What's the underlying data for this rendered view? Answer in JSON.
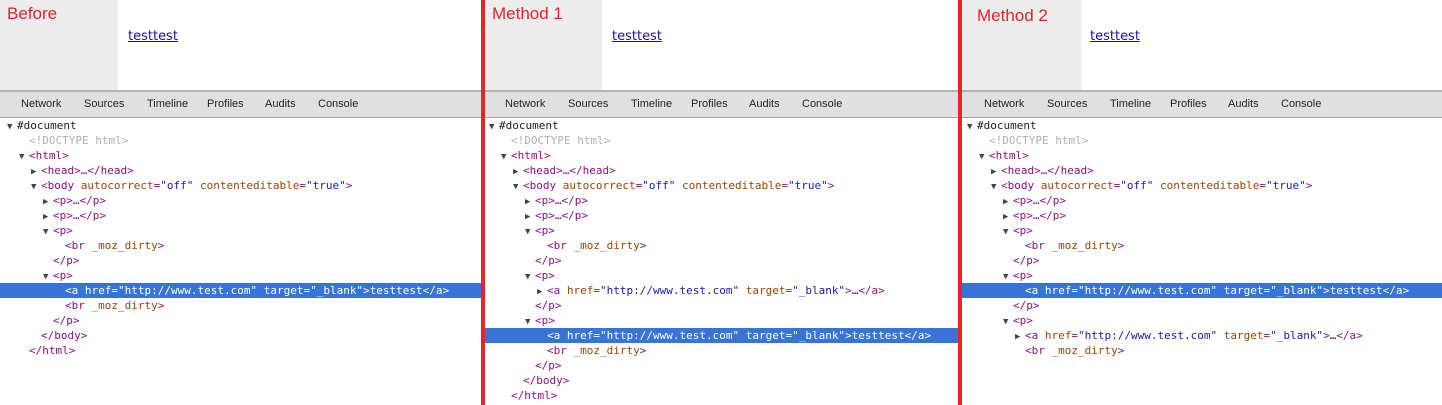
{
  "colors": {
    "divider": "#e8232b",
    "selection": "#3874d8",
    "tag": "#881280",
    "attr": "#994500",
    "value": "#1a1aa6"
  },
  "tabs": [
    "Network",
    "Sources",
    "Timeline",
    "Profiles",
    "Audits",
    "Console"
  ],
  "strings": {
    "document": "#document",
    "doctype": "<!DOCTYPE html>",
    "html_open": "<html>",
    "html_close": "</html>",
    "head": "<head>…</head>",
    "body_tag": "body",
    "body_attr1": "autocorrect",
    "body_val1": "\"off\"",
    "body_attr2": "contenteditable",
    "body_val2": "\"true\"",
    "body_close": "</body>",
    "p_collapsed": "<p>…</p>",
    "p_open": "<p>",
    "p_close": "</p>",
    "br_tag": "br",
    "br_attr": "_moz_dirty",
    "a_tag": "a",
    "a_attr1": "href",
    "a_val1": "\"http://www.test.com\"",
    "a_attr2": "target",
    "a_val2": "\"_blank\"",
    "a_text": "testtest",
    "a_ellipsis": "…",
    "a_close": "</a>"
  },
  "panels": [
    {
      "title": "Before",
      "link_text": "testtest",
      "lines": [
        {
          "indent": 0,
          "arrow": "down",
          "type": "doc"
        },
        {
          "indent": 1,
          "arrow": "none",
          "type": "doctype"
        },
        {
          "indent": 1,
          "arrow": "down",
          "type": "html_open"
        },
        {
          "indent": 2,
          "arrow": "right",
          "type": "head"
        },
        {
          "indent": 2,
          "arrow": "down",
          "type": "body_open"
        },
        {
          "indent": 3,
          "arrow": "right",
          "type": "p_collapsed"
        },
        {
          "indent": 3,
          "arrow": "right",
          "type": "p_collapsed"
        },
        {
          "indent": 3,
          "arrow": "down",
          "type": "p_open"
        },
        {
          "indent": 4,
          "arrow": "none",
          "type": "br"
        },
        {
          "indent": 3,
          "arrow": "none",
          "type": "p_close"
        },
        {
          "indent": 3,
          "arrow": "down",
          "type": "p_open"
        },
        {
          "indent": 4,
          "arrow": "none",
          "type": "a_full",
          "selected": true
        },
        {
          "indent": 4,
          "arrow": "none",
          "type": "br"
        },
        {
          "indent": 3,
          "arrow": "none",
          "type": "p_close"
        },
        {
          "indent": 2,
          "arrow": "none",
          "type": "body_close"
        },
        {
          "indent": 1,
          "arrow": "none",
          "type": "html_close"
        }
      ]
    },
    {
      "title": "Method 1",
      "link_text": "testtest",
      "lines": [
        {
          "indent": 0,
          "arrow": "down",
          "type": "doc"
        },
        {
          "indent": 1,
          "arrow": "none",
          "type": "doctype"
        },
        {
          "indent": 1,
          "arrow": "down",
          "type": "html_open"
        },
        {
          "indent": 2,
          "arrow": "right",
          "type": "head"
        },
        {
          "indent": 2,
          "arrow": "down",
          "type": "body_open"
        },
        {
          "indent": 3,
          "arrow": "right",
          "type": "p_collapsed"
        },
        {
          "indent": 3,
          "arrow": "right",
          "type": "p_collapsed"
        },
        {
          "indent": 3,
          "arrow": "down",
          "type": "p_open"
        },
        {
          "indent": 4,
          "arrow": "none",
          "type": "br"
        },
        {
          "indent": 3,
          "arrow": "none",
          "type": "p_close"
        },
        {
          "indent": 3,
          "arrow": "down",
          "type": "p_open"
        },
        {
          "indent": 4,
          "arrow": "right",
          "type": "a_collapsed"
        },
        {
          "indent": 3,
          "arrow": "none",
          "type": "p_close"
        },
        {
          "indent": 3,
          "arrow": "down",
          "type": "p_open"
        },
        {
          "indent": 4,
          "arrow": "none",
          "type": "a_full",
          "selected": true
        },
        {
          "indent": 4,
          "arrow": "none",
          "type": "br"
        },
        {
          "indent": 3,
          "arrow": "none",
          "type": "p_close"
        },
        {
          "indent": 2,
          "arrow": "none",
          "type": "body_close"
        },
        {
          "indent": 1,
          "arrow": "none",
          "type": "html_close"
        }
      ]
    },
    {
      "title": "Method 2",
      "link_text": "testtest",
      "lines": [
        {
          "indent": 0,
          "arrow": "down",
          "type": "doc"
        },
        {
          "indent": 1,
          "arrow": "none",
          "type": "doctype"
        },
        {
          "indent": 1,
          "arrow": "down",
          "type": "html_open"
        },
        {
          "indent": 2,
          "arrow": "right",
          "type": "head"
        },
        {
          "indent": 2,
          "arrow": "down",
          "type": "body_open"
        },
        {
          "indent": 3,
          "arrow": "right",
          "type": "p_collapsed"
        },
        {
          "indent": 3,
          "arrow": "right",
          "type": "p_collapsed"
        },
        {
          "indent": 3,
          "arrow": "down",
          "type": "p_open"
        },
        {
          "indent": 4,
          "arrow": "none",
          "type": "br"
        },
        {
          "indent": 3,
          "arrow": "none",
          "type": "p_close"
        },
        {
          "indent": 3,
          "arrow": "down",
          "type": "p_open"
        },
        {
          "indent": 4,
          "arrow": "none",
          "type": "a_full",
          "selected": true
        },
        {
          "indent": 3,
          "arrow": "none",
          "type": "p_close"
        },
        {
          "indent": 3,
          "arrow": "down",
          "type": "p_open"
        },
        {
          "indent": 4,
          "arrow": "right",
          "type": "a_collapsed"
        },
        {
          "indent": 4,
          "arrow": "none",
          "type": "br"
        }
      ]
    }
  ]
}
